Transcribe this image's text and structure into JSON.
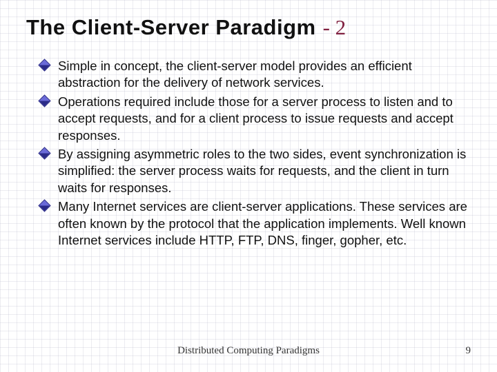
{
  "title": {
    "main": "The Client-Server Paradigm",
    "suffix": "- 2"
  },
  "bullets": [
    "Simple in concept, the client-server model provides an efficient abstraction for the delivery of network services.",
    "Operations required include those for a server process to listen and to accept requests, and for a client process to issue requests and accept responses.",
    "By assigning asymmetric roles to the two sides, event synchronization is simplified: the server process waits for requests, and the client in turn waits for responses.",
    " Many Internet services are client-server applications.  These services are often known by the protocol that the application implements. Well known Internet services include HTTP, FTP, DNS, finger, gopher, etc."
  ],
  "footer": {
    "text": "Distributed Computing Paradigms",
    "page": "9"
  }
}
